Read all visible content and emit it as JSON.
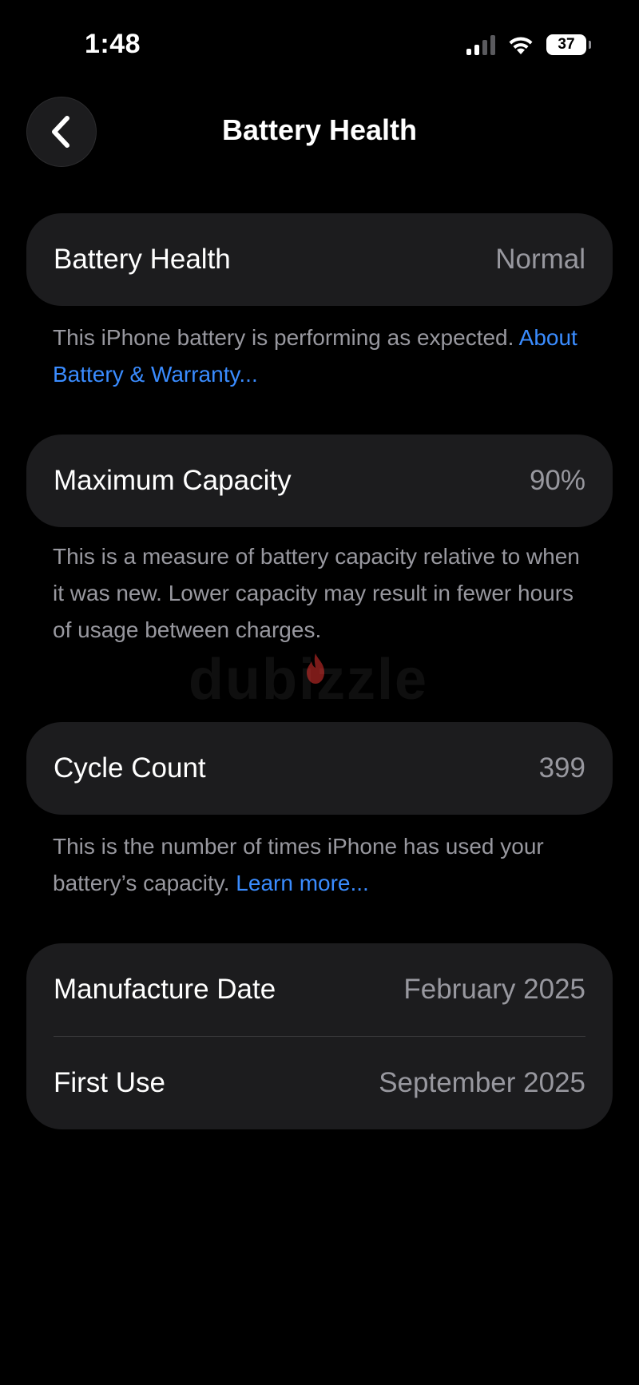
{
  "status_bar": {
    "time": "1:48",
    "battery_level": "37",
    "signal_bars_active": 2,
    "signal_bars_total": 4
  },
  "nav": {
    "back_icon": "chevron-left-icon",
    "title": "Battery Health"
  },
  "sections": {
    "battery_health": {
      "label": "Battery Health",
      "value": "Normal",
      "footnote_text": "This iPhone battery is performing as expected. ",
      "footnote_link": "About Battery & Warranty..."
    },
    "maximum_capacity": {
      "label": "Maximum Capacity",
      "value": "90%",
      "footnote_text": "This is a measure of battery capacity relative to when it was new. Lower capacity may result in fewer hours of usage between charges."
    },
    "cycle_count": {
      "label": "Cycle Count",
      "value": "399",
      "footnote_text": "This is the number of times iPhone has used your battery’s capacity. ",
      "footnote_link": "Learn more..."
    },
    "dates": {
      "manufacture_label": "Manufacture Date",
      "manufacture_value": "February 2025",
      "first_use_label": "First Use",
      "first_use_value": "September 2025"
    }
  },
  "watermark": {
    "text": "dubizzle"
  },
  "colors": {
    "background": "#000000",
    "card": "#1c1c1e",
    "secondary_text": "#98989f",
    "link": "#3a8cff"
  }
}
